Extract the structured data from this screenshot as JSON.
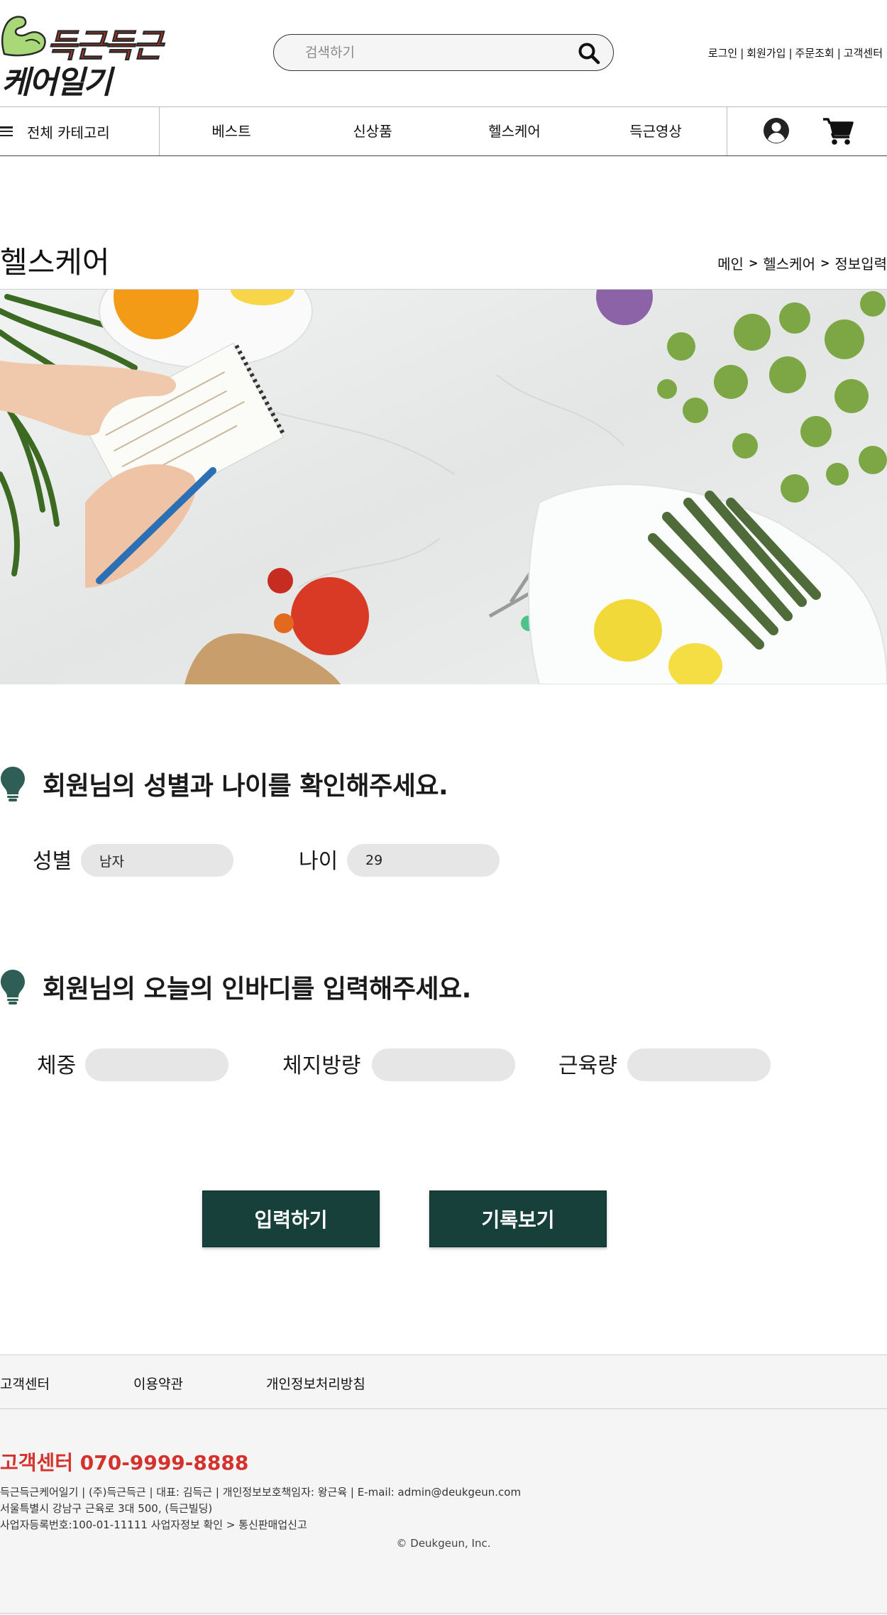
{
  "header": {
    "logo": {
      "line1": "득근득근",
      "line2": "케어일기"
    },
    "search": {
      "placeholder": "검색하기"
    },
    "util_links": [
      "로그인",
      "회원가입",
      "주문조회",
      "고객센터"
    ]
  },
  "nav": {
    "all_categories": "전체 카테고리",
    "items": [
      "베스트",
      "신상품",
      "헬스케어",
      "득근영상"
    ]
  },
  "page": {
    "title": "헬스케어",
    "breadcrumb": [
      "메인",
      "헬스케어",
      "정보입력"
    ]
  },
  "section1": {
    "title": "회원님의 성별과 나이를 확인해주세요.",
    "gender_label": "성별",
    "gender_value": "남자",
    "age_label": "나이",
    "age_value": "29"
  },
  "section2": {
    "title": "회원님의 오늘의 인바디를 입력해주세요.",
    "weight_label": "체중",
    "weight_value": "",
    "fat_label": "체지방량",
    "fat_value": "",
    "muscle_label": "근육량",
    "muscle_value": ""
  },
  "buttons": {
    "submit": "입력하기",
    "history": "기록보기"
  },
  "footer": {
    "links": [
      "고객센터",
      "이용약관",
      "개인정보처리방침"
    ],
    "cs_phone": "고객센터 070-9999-8888",
    "info_line1": "득근득근케어일기 | (주)득근득근 | 대표: 김득근 | 개인정보보호책임자: 왕근육 | E-mail: admin@deukgeun.com",
    "info_line2": "서울특별시 강남구 근육로 3대 500, (득근빌딩)",
    "info_line3": "사업자등록번호:100-01-11111 사업자정보 확인 > 통신판매업신고",
    "copyright": "© Deukgeun, Inc."
  },
  "colors": {
    "brand_red": "#e0321d",
    "button_green": "#17403b",
    "phone_red": "#d4322d",
    "bulb_green": "#2e5e55"
  },
  "icons": [
    "flexed-arm-logo-icon",
    "search-icon",
    "hamburger-icon",
    "user-icon",
    "cart-icon",
    "bulb-icon",
    "chevron-right-icon"
  ]
}
